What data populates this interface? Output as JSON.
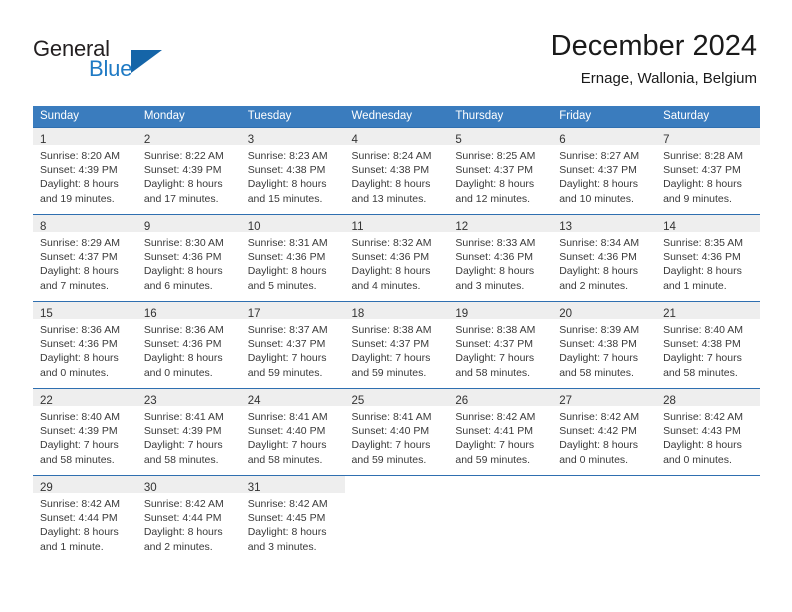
{
  "brand": {
    "name_part1": "General",
    "name_part2": "Blue",
    "triangle_color": "#1565a8",
    "blue_text_color": "#1f7ac4"
  },
  "header": {
    "title": "December 2024",
    "subtitle": "Ernage, Wallonia, Belgium"
  },
  "theme": {
    "header_row_bg": "#3a7cbe",
    "week_divider": "#2f6fb0",
    "daynum_band_bg": "#eeeeee"
  },
  "weekday_headers": [
    "Sunday",
    "Monday",
    "Tuesday",
    "Wednesday",
    "Thursday",
    "Friday",
    "Saturday"
  ],
  "weeks": [
    [
      {
        "day": "1",
        "sunrise": "Sunrise: 8:20 AM",
        "sunset": "Sunset: 4:39 PM",
        "daylight1": "Daylight: 8 hours",
        "daylight2": "and 19 minutes."
      },
      {
        "day": "2",
        "sunrise": "Sunrise: 8:22 AM",
        "sunset": "Sunset: 4:39 PM",
        "daylight1": "Daylight: 8 hours",
        "daylight2": "and 17 minutes."
      },
      {
        "day": "3",
        "sunrise": "Sunrise: 8:23 AM",
        "sunset": "Sunset: 4:38 PM",
        "daylight1": "Daylight: 8 hours",
        "daylight2": "and 15 minutes."
      },
      {
        "day": "4",
        "sunrise": "Sunrise: 8:24 AM",
        "sunset": "Sunset: 4:38 PM",
        "daylight1": "Daylight: 8 hours",
        "daylight2": "and 13 minutes."
      },
      {
        "day": "5",
        "sunrise": "Sunrise: 8:25 AM",
        "sunset": "Sunset: 4:37 PM",
        "daylight1": "Daylight: 8 hours",
        "daylight2": "and 12 minutes."
      },
      {
        "day": "6",
        "sunrise": "Sunrise: 8:27 AM",
        "sunset": "Sunset: 4:37 PM",
        "daylight1": "Daylight: 8 hours",
        "daylight2": "and 10 minutes."
      },
      {
        "day": "7",
        "sunrise": "Sunrise: 8:28 AM",
        "sunset": "Sunset: 4:37 PM",
        "daylight1": "Daylight: 8 hours",
        "daylight2": "and 9 minutes."
      }
    ],
    [
      {
        "day": "8",
        "sunrise": "Sunrise: 8:29 AM",
        "sunset": "Sunset: 4:37 PM",
        "daylight1": "Daylight: 8 hours",
        "daylight2": "and 7 minutes."
      },
      {
        "day": "9",
        "sunrise": "Sunrise: 8:30 AM",
        "sunset": "Sunset: 4:36 PM",
        "daylight1": "Daylight: 8 hours",
        "daylight2": "and 6 minutes."
      },
      {
        "day": "10",
        "sunrise": "Sunrise: 8:31 AM",
        "sunset": "Sunset: 4:36 PM",
        "daylight1": "Daylight: 8 hours",
        "daylight2": "and 5 minutes."
      },
      {
        "day": "11",
        "sunrise": "Sunrise: 8:32 AM",
        "sunset": "Sunset: 4:36 PM",
        "daylight1": "Daylight: 8 hours",
        "daylight2": "and 4 minutes."
      },
      {
        "day": "12",
        "sunrise": "Sunrise: 8:33 AM",
        "sunset": "Sunset: 4:36 PM",
        "daylight1": "Daylight: 8 hours",
        "daylight2": "and 3 minutes."
      },
      {
        "day": "13",
        "sunrise": "Sunrise: 8:34 AM",
        "sunset": "Sunset: 4:36 PM",
        "daylight1": "Daylight: 8 hours",
        "daylight2": "and 2 minutes."
      },
      {
        "day": "14",
        "sunrise": "Sunrise: 8:35 AM",
        "sunset": "Sunset: 4:36 PM",
        "daylight1": "Daylight: 8 hours",
        "daylight2": "and 1 minute."
      }
    ],
    [
      {
        "day": "15",
        "sunrise": "Sunrise: 8:36 AM",
        "sunset": "Sunset: 4:36 PM",
        "daylight1": "Daylight: 8 hours",
        "daylight2": "and 0 minutes."
      },
      {
        "day": "16",
        "sunrise": "Sunrise: 8:36 AM",
        "sunset": "Sunset: 4:36 PM",
        "daylight1": "Daylight: 8 hours",
        "daylight2": "and 0 minutes."
      },
      {
        "day": "17",
        "sunrise": "Sunrise: 8:37 AM",
        "sunset": "Sunset: 4:37 PM",
        "daylight1": "Daylight: 7 hours",
        "daylight2": "and 59 minutes."
      },
      {
        "day": "18",
        "sunrise": "Sunrise: 8:38 AM",
        "sunset": "Sunset: 4:37 PM",
        "daylight1": "Daylight: 7 hours",
        "daylight2": "and 59 minutes."
      },
      {
        "day": "19",
        "sunrise": "Sunrise: 8:38 AM",
        "sunset": "Sunset: 4:37 PM",
        "daylight1": "Daylight: 7 hours",
        "daylight2": "and 58 minutes."
      },
      {
        "day": "20",
        "sunrise": "Sunrise: 8:39 AM",
        "sunset": "Sunset: 4:38 PM",
        "daylight1": "Daylight: 7 hours",
        "daylight2": "and 58 minutes."
      },
      {
        "day": "21",
        "sunrise": "Sunrise: 8:40 AM",
        "sunset": "Sunset: 4:38 PM",
        "daylight1": "Daylight: 7 hours",
        "daylight2": "and 58 minutes."
      }
    ],
    [
      {
        "day": "22",
        "sunrise": "Sunrise: 8:40 AM",
        "sunset": "Sunset: 4:39 PM",
        "daylight1": "Daylight: 7 hours",
        "daylight2": "and 58 minutes."
      },
      {
        "day": "23",
        "sunrise": "Sunrise: 8:41 AM",
        "sunset": "Sunset: 4:39 PM",
        "daylight1": "Daylight: 7 hours",
        "daylight2": "and 58 minutes."
      },
      {
        "day": "24",
        "sunrise": "Sunrise: 8:41 AM",
        "sunset": "Sunset: 4:40 PM",
        "daylight1": "Daylight: 7 hours",
        "daylight2": "and 58 minutes."
      },
      {
        "day": "25",
        "sunrise": "Sunrise: 8:41 AM",
        "sunset": "Sunset: 4:40 PM",
        "daylight1": "Daylight: 7 hours",
        "daylight2": "and 59 minutes."
      },
      {
        "day": "26",
        "sunrise": "Sunrise: 8:42 AM",
        "sunset": "Sunset: 4:41 PM",
        "daylight1": "Daylight: 7 hours",
        "daylight2": "and 59 minutes."
      },
      {
        "day": "27",
        "sunrise": "Sunrise: 8:42 AM",
        "sunset": "Sunset: 4:42 PM",
        "daylight1": "Daylight: 8 hours",
        "daylight2": "and 0 minutes."
      },
      {
        "day": "28",
        "sunrise": "Sunrise: 8:42 AM",
        "sunset": "Sunset: 4:43 PM",
        "daylight1": "Daylight: 8 hours",
        "daylight2": "and 0 minutes."
      }
    ],
    [
      {
        "day": "29",
        "sunrise": "Sunrise: 8:42 AM",
        "sunset": "Sunset: 4:44 PM",
        "daylight1": "Daylight: 8 hours",
        "daylight2": "and 1 minute."
      },
      {
        "day": "30",
        "sunrise": "Sunrise: 8:42 AM",
        "sunset": "Sunset: 4:44 PM",
        "daylight1": "Daylight: 8 hours",
        "daylight2": "and 2 minutes."
      },
      {
        "day": "31",
        "sunrise": "Sunrise: 8:42 AM",
        "sunset": "Sunset: 4:45 PM",
        "daylight1": "Daylight: 8 hours",
        "daylight2": "and 3 minutes."
      },
      {
        "day": "",
        "sunrise": "",
        "sunset": "",
        "daylight1": "",
        "daylight2": ""
      },
      {
        "day": "",
        "sunrise": "",
        "sunset": "",
        "daylight1": "",
        "daylight2": ""
      },
      {
        "day": "",
        "sunrise": "",
        "sunset": "",
        "daylight1": "",
        "daylight2": ""
      },
      {
        "day": "",
        "sunrise": "",
        "sunset": "",
        "daylight1": "",
        "daylight2": ""
      }
    ]
  ]
}
